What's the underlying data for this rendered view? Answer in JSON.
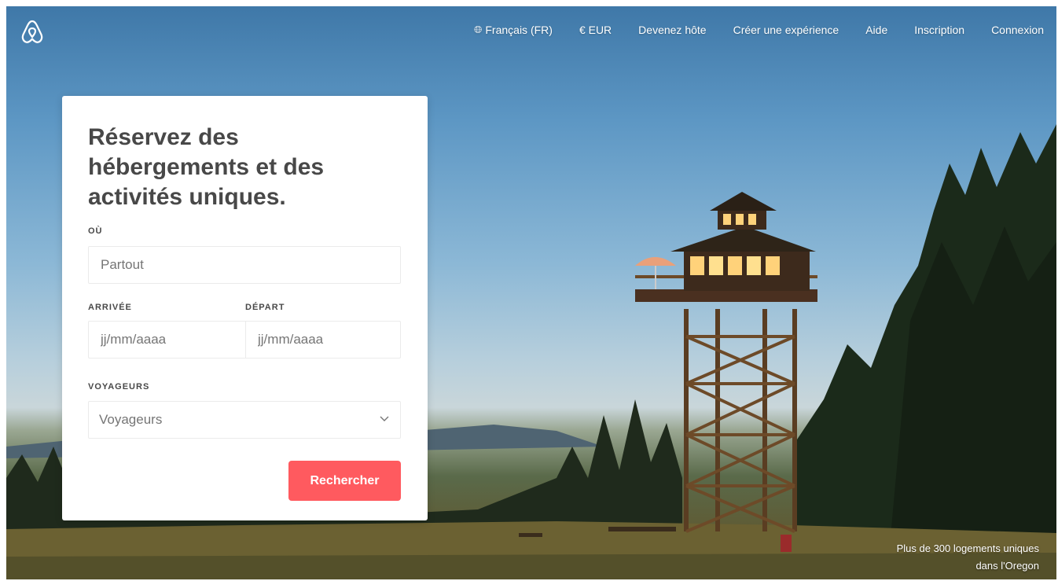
{
  "header": {
    "logo_icon": "airbnb-belo-icon",
    "nav": [
      {
        "label": "Français (FR)",
        "icon": "globe-icon"
      },
      {
        "label": "€ EUR"
      },
      {
        "label": "Devenez hôte"
      },
      {
        "label": "Créer une expérience"
      },
      {
        "label": "Aide"
      },
      {
        "label": "Inscription"
      },
      {
        "label": "Connexion"
      }
    ]
  },
  "search_card": {
    "title": "Réservez des hébergements et des activités uniques.",
    "where_label": "OÙ",
    "where_placeholder": "Partout",
    "checkin_label": "ARRIVÉE",
    "checkin_placeholder": "jj/mm/aaaa",
    "checkout_label": "DÉPART",
    "checkout_placeholder": "jj/mm/aaaa",
    "guests_label": "VOYAGEURS",
    "guests_value": "Voyageurs",
    "search_button": "Rechercher"
  },
  "caption": {
    "line1": "Plus de 300 logements uniques",
    "line2": "dans l'Oregon"
  },
  "colors": {
    "accent": "#ff5a5f",
    "text_dark": "#484848",
    "border": "#ebebeb"
  }
}
